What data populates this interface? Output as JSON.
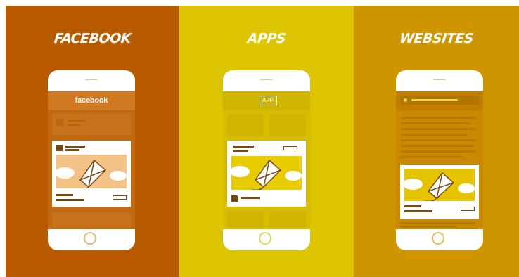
{
  "panels": [
    {
      "title": "FACEBOOK",
      "logo": "facebook",
      "icon": "phone-icon"
    },
    {
      "title": "APPS",
      "badge": "APP",
      "icon": "phone-icon"
    },
    {
      "title": "WEBSITES",
      "icon": "phone-icon"
    }
  ],
  "colors": {
    "facebook_bg": "#b85a00",
    "apps_bg": "#dcc400",
    "websites_bg": "#cf9500",
    "card": "#ffffff"
  },
  "illustration": "kite-icon"
}
